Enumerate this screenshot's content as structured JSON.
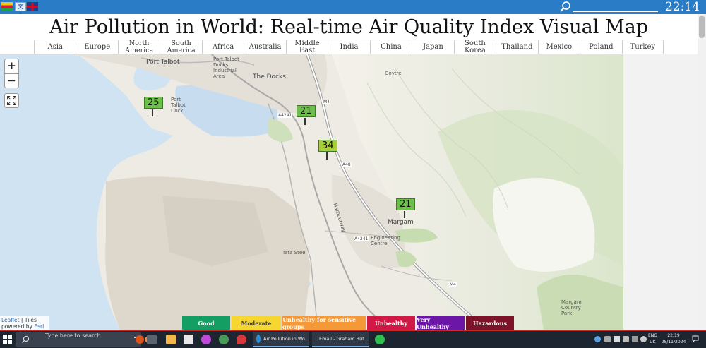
{
  "topbar": {
    "translate_label": "文A",
    "clock": "22:14"
  },
  "page": {
    "title": "Air Pollution in World: Real-time Air Quality Index Visual Map"
  },
  "nav": [
    "Asia",
    "Europe",
    "North America",
    "South America",
    "Africa",
    "Australia",
    "Middle East",
    "India",
    "China",
    "Japan",
    "South Korea",
    "Thailand",
    "Mexico",
    "Poland",
    "Turkey"
  ],
  "map": {
    "zoom_in": "+",
    "zoom_out": "−",
    "markers": [
      {
        "value": "25",
        "level": "good"
      },
      {
        "value": "21",
        "level": "good"
      },
      {
        "value": "34",
        "level": "good"
      },
      {
        "value": "21",
        "level": "good"
      }
    ],
    "places": {
      "port_talbot": "Port Talbot",
      "the_docks": "The Docks",
      "port_talbot_docks_industrial": "Port Talbot Docks Industrial Area",
      "port_talbot_dock": "Port Talbot Dock",
      "goytre": "Goytre",
      "margam": "Margam",
      "tata_steel": "Tata Steel",
      "engineering_centre": "Engineering Centre",
      "margam_country_park": "Margam Country Park",
      "harbourway": "Harbourway"
    },
    "roads": {
      "a4241": "A4241",
      "m4": "M4",
      "a48": "A48"
    }
  },
  "attribution": {
    "leaflet": "Leaflet",
    "sep": " | Tiles",
    "powered": "powered by",
    "esri": "Esri"
  },
  "legend": [
    {
      "label": "Good",
      "color": "#139f63"
    },
    {
      "label": "Moderate",
      "color": "#f6d631"
    },
    {
      "label": "Unhealthy for sensitive groups",
      "color": "#f59838"
    },
    {
      "label": "Unhealthy",
      "color": "#d21946"
    },
    {
      "label": "Very Unhealthy",
      "color": "#6c16a8"
    },
    {
      "label": "Hazardous",
      "color": "#7d1329"
    }
  ],
  "taskbar": {
    "search_placeholder": "Type here to search",
    "app1_label": "Air Pollution in Wo...",
    "app2_label": "Email - Graham But...",
    "lang_top": "ENG",
    "lang_bottom": "UK",
    "time": "22:19",
    "date": "28/11/2024"
  }
}
